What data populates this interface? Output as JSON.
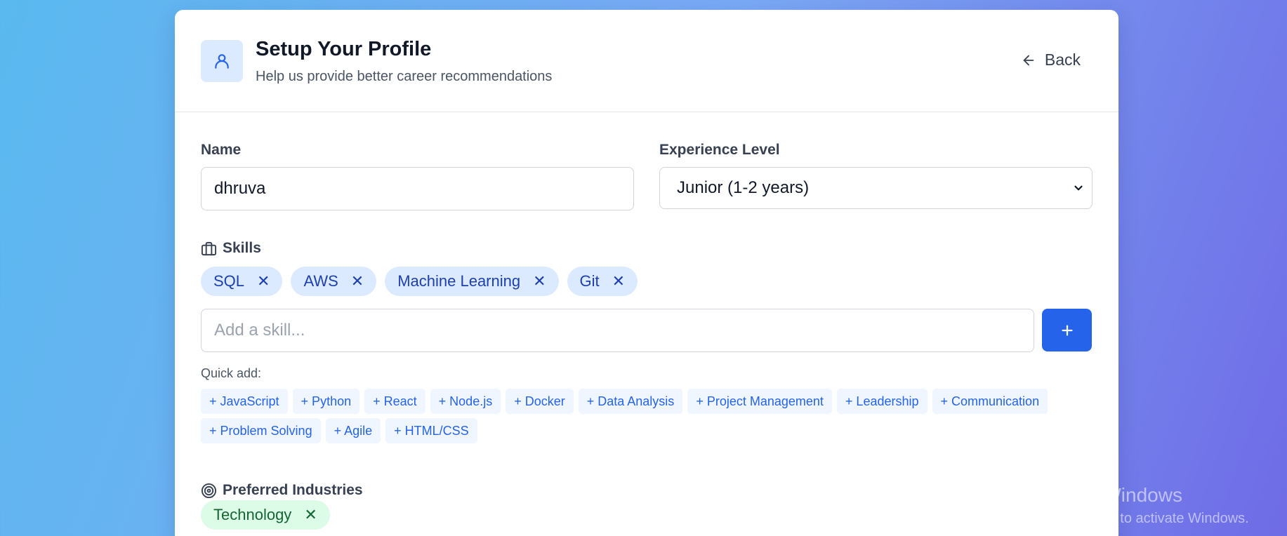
{
  "header": {
    "title": "Setup Your Profile",
    "subtitle": "Help us provide better career recommendations",
    "back_label": "Back"
  },
  "form": {
    "name_label": "Name",
    "name_value": "dhruva",
    "experience_label": "Experience Level",
    "experience_value": "Junior (1-2 years)"
  },
  "skills": {
    "label": "Skills",
    "selected": [
      "SQL",
      "AWS",
      "Machine Learning",
      "Git"
    ],
    "input_placeholder": "Add a skill...",
    "quick_add_label": "Quick add:",
    "quick_add": [
      "+ JavaScript",
      "+ Python",
      "+ React",
      "+ Node.js",
      "+ Docker",
      "+ Data Analysis",
      "+ Project Management",
      "+ Leadership",
      "+ Communication",
      "+ Problem Solving",
      "+ Agile",
      "+ HTML/CSS"
    ]
  },
  "industries": {
    "label": "Preferred Industries",
    "selected": [
      "Technology"
    ]
  },
  "watermark": {
    "title": "Activate Windows",
    "subtitle": "Go to Settings to activate Windows."
  },
  "colors": {
    "accent": "#2563eb",
    "chip_blue_bg": "#dbeafe",
    "chip_green_bg": "#dcfce7"
  }
}
